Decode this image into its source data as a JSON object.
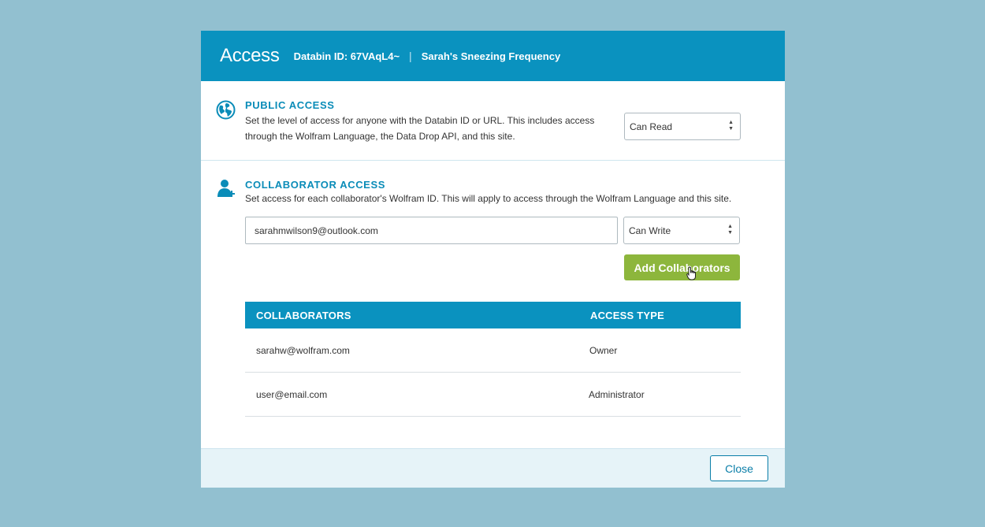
{
  "header": {
    "title": "Access",
    "databin_id": "Databin ID: 67VAqL4~",
    "separator": "|",
    "databin_name": "Sarah's Sneezing Frequency"
  },
  "public_access": {
    "title": "PUBLIC ACCESS",
    "description": "Set the level of access for anyone with the Databin ID or URL. This includes access through the Wolfram Language, the Data Drop API, and this site.",
    "select_value": "Can Read",
    "icon": "globe-icon"
  },
  "collaborator_access": {
    "title": "COLLABORATOR ACCESS",
    "description": "Set access for each collaborator's Wolfram ID. This will apply to access through the Wolfram Language and this site.",
    "email_value": "sarahmwilson9@outlook.com",
    "select_value": "Can Write",
    "add_button": "Add Collaborators",
    "icon": "add-user-icon"
  },
  "table": {
    "headers": [
      "COLLABORATORS",
      "ACCESS TYPE"
    ],
    "rows": [
      {
        "collaborator": "sarahw@wolfram.com",
        "access": "Owner"
      },
      {
        "collaborator": "user@email.com",
        "access": "Administrator"
      }
    ]
  },
  "footer": {
    "close_button": "Close"
  },
  "colors": {
    "background": "#92c0d0",
    "header": "#0a92bf",
    "accent_text": "#0a8cb8",
    "add_button": "#8db63c",
    "footer": "#e6f3f8"
  }
}
